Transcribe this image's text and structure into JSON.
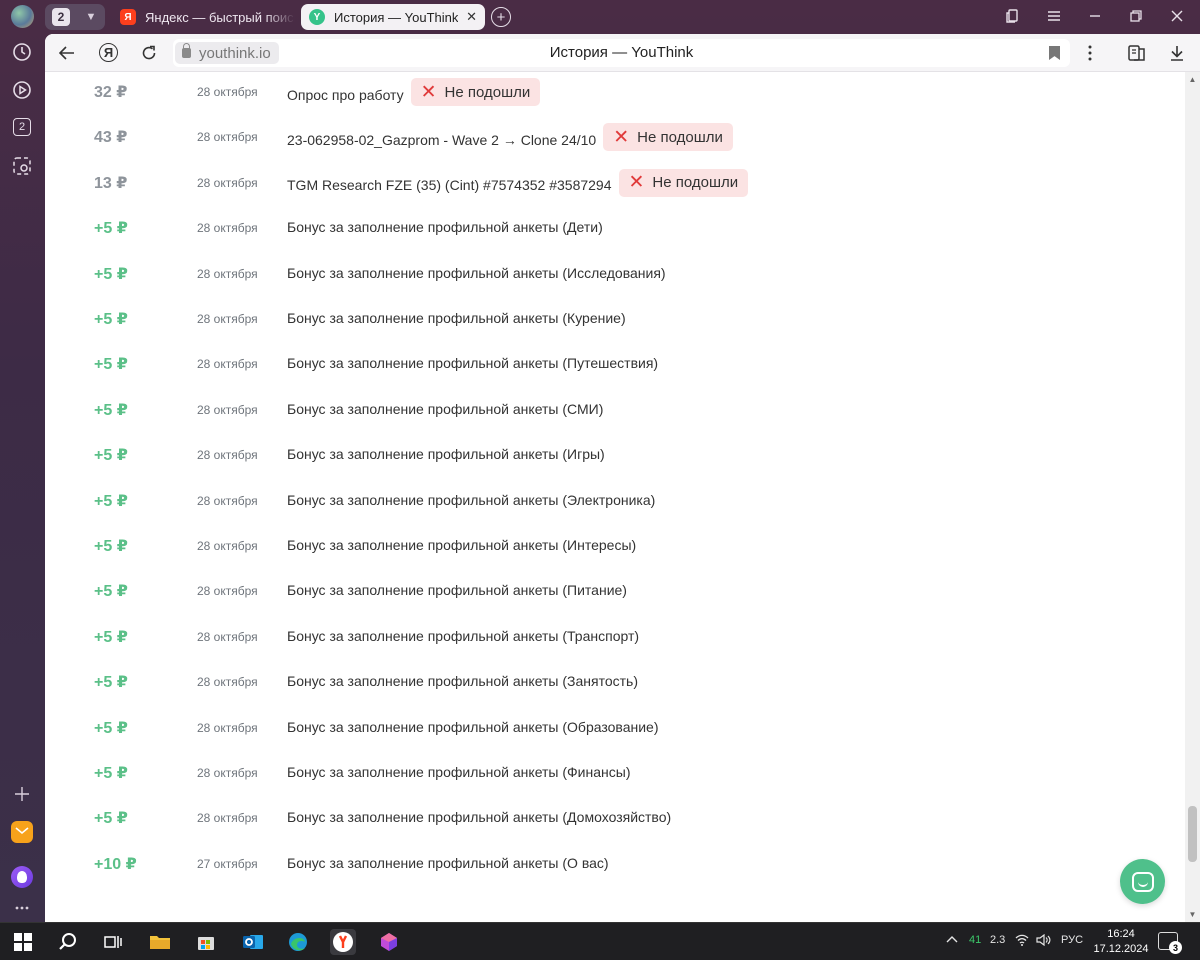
{
  "tabbar": {
    "tab_count": "2",
    "tabs": [
      {
        "favicon": "Я",
        "title": "Яндекс — быстрый поиск в интернете"
      },
      {
        "favicon": "Y",
        "title": "История — YouThink",
        "close": "✕"
      }
    ],
    "new_tab": "+"
  },
  "sidebar": {
    "tabs_badge": "2"
  },
  "addressbar": {
    "ya_button": "Я",
    "domain": "youthink.io",
    "page_title": "История — YouThink"
  },
  "history": {
    "failed_label": "Не подошли",
    "rows": [
      {
        "amount": "32 ₽",
        "type": "neg",
        "date": "28 октября",
        "desc": "Опрос про работу",
        "failed": true
      },
      {
        "amount": "43 ₽",
        "type": "neg",
        "date": "28 октября",
        "desc": "23-062958-02_Gazprom - Wave 2 → Clone 24/10",
        "failed": true
      },
      {
        "amount": "13 ₽",
        "type": "neg",
        "date": "28 октября",
        "desc": "TGM Research FZE (35) (Cint) #7574352 #3587294",
        "failed": true
      },
      {
        "amount": "+5 ₽",
        "type": "pos",
        "date": "28 октября",
        "desc": "Бонус за заполнение профильной анкеты (Дети)",
        "failed": false
      },
      {
        "amount": "+5 ₽",
        "type": "pos",
        "date": "28 октября",
        "desc": "Бонус за заполнение профильной анкеты (Исследования)",
        "failed": false
      },
      {
        "amount": "+5 ₽",
        "type": "pos",
        "date": "28 октября",
        "desc": "Бонус за заполнение профильной анкеты (Курение)",
        "failed": false
      },
      {
        "amount": "+5 ₽",
        "type": "pos",
        "date": "28 октября",
        "desc": "Бонус за заполнение профильной анкеты (Путешествия)",
        "failed": false
      },
      {
        "amount": "+5 ₽",
        "type": "pos",
        "date": "28 октября",
        "desc": "Бонус за заполнение профильной анкеты (СМИ)",
        "failed": false
      },
      {
        "amount": "+5 ₽",
        "type": "pos",
        "date": "28 октября",
        "desc": "Бонус за заполнение профильной анкеты (Игры)",
        "failed": false
      },
      {
        "amount": "+5 ₽",
        "type": "pos",
        "date": "28 октября",
        "desc": "Бонус за заполнение профильной анкеты (Электроника)",
        "failed": false
      },
      {
        "amount": "+5 ₽",
        "type": "pos",
        "date": "28 октября",
        "desc": "Бонус за заполнение профильной анкеты (Интересы)",
        "failed": false
      },
      {
        "amount": "+5 ₽",
        "type": "pos",
        "date": "28 октября",
        "desc": "Бонус за заполнение профильной анкеты (Питание)",
        "failed": false
      },
      {
        "amount": "+5 ₽",
        "type": "pos",
        "date": "28 октября",
        "desc": "Бонус за заполнение профильной анкеты (Транспорт)",
        "failed": false
      },
      {
        "amount": "+5 ₽",
        "type": "pos",
        "date": "28 октября",
        "desc": "Бонус за заполнение профильной анкеты (Занятость)",
        "failed": false
      },
      {
        "amount": "+5 ₽",
        "type": "pos",
        "date": "28 октября",
        "desc": "Бонус за заполнение профильной анкеты (Образование)",
        "failed": false
      },
      {
        "amount": "+5 ₽",
        "type": "pos",
        "date": "28 октября",
        "desc": "Бонус за заполнение профильной анкеты (Финансы)",
        "failed": false
      },
      {
        "amount": "+5 ₽",
        "type": "pos",
        "date": "28 октября",
        "desc": "Бонус за заполнение профильной анкеты (Домохозяйство)",
        "failed": false
      },
      {
        "amount": "+10 ₽",
        "type": "pos",
        "date": "27 октября",
        "desc": "Бонус за заполнение профильной анкеты (О вас)",
        "failed": false
      }
    ]
  },
  "colors": {
    "positive": "#5bc088",
    "neutral": "#8e949b",
    "failed_bg": "#fbe3e3",
    "failed_icon": "#e03a3a",
    "chat_button": "#4fc08b"
  },
  "taskbar": {
    "tray_temp": "41",
    "tray_val": "2.3",
    "lang": "РУС",
    "time": "16:24",
    "date": "17.12.2024",
    "notifications": "3"
  }
}
